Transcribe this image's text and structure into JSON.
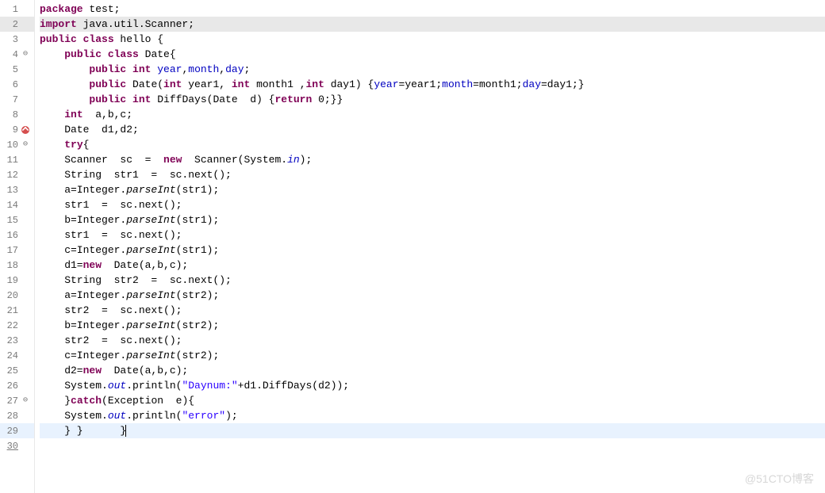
{
  "watermark": "@51CTO博客",
  "gutter": {
    "lines": [
      {
        "n": "1",
        "marker": null
      },
      {
        "n": "2",
        "marker": null,
        "highlight": "import"
      },
      {
        "n": "3",
        "marker": null
      },
      {
        "n": "4",
        "marker": "fold"
      },
      {
        "n": "5",
        "marker": null
      },
      {
        "n": "6",
        "marker": null
      },
      {
        "n": "7",
        "marker": null
      },
      {
        "n": "8",
        "marker": null
      },
      {
        "n": "9",
        "marker": "error"
      },
      {
        "n": "10",
        "marker": "fold"
      },
      {
        "n": "11",
        "marker": null
      },
      {
        "n": "12",
        "marker": null
      },
      {
        "n": "13",
        "marker": null
      },
      {
        "n": "14",
        "marker": null
      },
      {
        "n": "15",
        "marker": null
      },
      {
        "n": "16",
        "marker": null
      },
      {
        "n": "17",
        "marker": null
      },
      {
        "n": "18",
        "marker": null
      },
      {
        "n": "19",
        "marker": null
      },
      {
        "n": "20",
        "marker": null
      },
      {
        "n": "21",
        "marker": null
      },
      {
        "n": "22",
        "marker": null
      },
      {
        "n": "23",
        "marker": null
      },
      {
        "n": "24",
        "marker": null
      },
      {
        "n": "25",
        "marker": null
      },
      {
        "n": "26",
        "marker": null
      },
      {
        "n": "27",
        "marker": "fold"
      },
      {
        "n": "28",
        "marker": null
      },
      {
        "n": "29",
        "marker": null,
        "highlight": "current"
      },
      {
        "n": "30",
        "marker": null,
        "underline": true
      }
    ]
  },
  "code": [
    {
      "tokens": [
        [
          "kw",
          "package"
        ],
        [
          "",
          " test;"
        ]
      ]
    },
    {
      "hl": "import",
      "tokens": [
        [
          "kw",
          "import"
        ],
        [
          "",
          " java.util.Scanner;"
        ]
      ]
    },
    {
      "tokens": [
        [
          "kw",
          "public class"
        ],
        [
          "",
          " hello {"
        ]
      ]
    },
    {
      "tokens": [
        [
          "",
          "    "
        ],
        [
          "kw",
          "public class"
        ],
        [
          "",
          " Date{"
        ]
      ]
    },
    {
      "tokens": [
        [
          "",
          "        "
        ],
        [
          "kw",
          "public int"
        ],
        [
          "",
          " "
        ],
        [
          "fld",
          "year"
        ],
        [
          "",
          ","
        ],
        [
          "fld",
          "month"
        ],
        [
          "",
          ","
        ],
        [
          "fld",
          "day"
        ],
        [
          "",
          ";"
        ]
      ]
    },
    {
      "tokens": [
        [
          "",
          "        "
        ],
        [
          "kw",
          "public"
        ],
        [
          "",
          " Date("
        ],
        [
          "kw",
          "int"
        ],
        [
          "",
          " year1, "
        ],
        [
          "kw",
          "int"
        ],
        [
          "",
          " month1 ,"
        ],
        [
          "kw",
          "int"
        ],
        [
          "",
          " day1) {"
        ],
        [
          "fld",
          "year"
        ],
        [
          "",
          "=year1;"
        ],
        [
          "fld",
          "month"
        ],
        [
          "",
          "=month1;"
        ],
        [
          "fld",
          "day"
        ],
        [
          "",
          "=day1;}"
        ]
      ]
    },
    {
      "tokens": [
        [
          "",
          "        "
        ],
        [
          "kw",
          "public int"
        ],
        [
          "",
          " DiffDays(Date  d) {"
        ],
        [
          "kw",
          "return"
        ],
        [
          "",
          " 0;}}"
        ]
      ]
    },
    {
      "tokens": [
        [
          "",
          "    "
        ],
        [
          "kw",
          "int"
        ],
        [
          "",
          "  a,b,c;"
        ]
      ]
    },
    {
      "tokens": [
        [
          "",
          "    Date  d1,d2;"
        ]
      ]
    },
    {
      "tokens": [
        [
          "",
          "    "
        ],
        [
          "kw",
          "try"
        ],
        [
          "",
          "{"
        ]
      ]
    },
    {
      "tokens": [
        [
          "",
          "    Scanner  sc  =  "
        ],
        [
          "kw",
          "new"
        ],
        [
          "",
          "  Scanner(System."
        ],
        [
          "fldi",
          "in"
        ],
        [
          "",
          ");"
        ]
      ]
    },
    {
      "tokens": [
        [
          "",
          "    String  str1  =  sc.next();"
        ]
      ]
    },
    {
      "tokens": [
        [
          "",
          "    a=Integer."
        ],
        [
          "mtd",
          "parseInt"
        ],
        [
          "",
          "(str1);"
        ]
      ]
    },
    {
      "tokens": [
        [
          "",
          "    str1  =  sc.next();"
        ]
      ]
    },
    {
      "tokens": [
        [
          "",
          "    b=Integer."
        ],
        [
          "mtd",
          "parseInt"
        ],
        [
          "",
          "(str1);"
        ]
      ]
    },
    {
      "tokens": [
        [
          "",
          "    str1  =  sc.next();"
        ]
      ]
    },
    {
      "tokens": [
        [
          "",
          "    c=Integer."
        ],
        [
          "mtd",
          "parseInt"
        ],
        [
          "",
          "(str1);"
        ]
      ]
    },
    {
      "tokens": [
        [
          "",
          "    d1="
        ],
        [
          "kw",
          "new"
        ],
        [
          "",
          "  Date(a,b,c);"
        ]
      ]
    },
    {
      "tokens": [
        [
          "",
          "    String  str2  =  sc.next();"
        ]
      ]
    },
    {
      "tokens": [
        [
          "",
          "    a=Integer."
        ],
        [
          "mtd",
          "parseInt"
        ],
        [
          "",
          "(str2);"
        ]
      ]
    },
    {
      "tokens": [
        [
          "",
          "    str2  =  sc.next();"
        ]
      ]
    },
    {
      "tokens": [
        [
          "",
          "    b=Integer."
        ],
        [
          "mtd",
          "parseInt"
        ],
        [
          "",
          "(str2);"
        ]
      ]
    },
    {
      "tokens": [
        [
          "",
          "    str2  =  sc.next();"
        ]
      ]
    },
    {
      "tokens": [
        [
          "",
          "    c=Integer."
        ],
        [
          "mtd",
          "parseInt"
        ],
        [
          "",
          "(str2);"
        ]
      ]
    },
    {
      "tokens": [
        [
          "",
          "    d2="
        ],
        [
          "kw",
          "new"
        ],
        [
          "",
          "  Date(a,b,c);"
        ]
      ]
    },
    {
      "tokens": [
        [
          "",
          "    System."
        ],
        [
          "fldi",
          "out"
        ],
        [
          "",
          ".println("
        ],
        [
          "str",
          "\"Daynum:\""
        ],
        [
          "",
          "+d1.DiffDays(d2));"
        ]
      ]
    },
    {
      "tokens": [
        [
          "",
          "    }"
        ],
        [
          "kw",
          "catch"
        ],
        [
          "",
          "(Exception  e){"
        ]
      ]
    },
    {
      "tokens": [
        [
          "",
          "    System."
        ],
        [
          "fldi",
          "out"
        ],
        [
          "",
          ".println("
        ],
        [
          "str",
          "\"error\""
        ],
        [
          "",
          ");"
        ]
      ]
    },
    {
      "hl": "current",
      "cursor": true,
      "tokens": [
        [
          "",
          "    } }      }"
        ]
      ]
    },
    {
      "tokens": [
        [
          "",
          ""
        ]
      ]
    }
  ]
}
